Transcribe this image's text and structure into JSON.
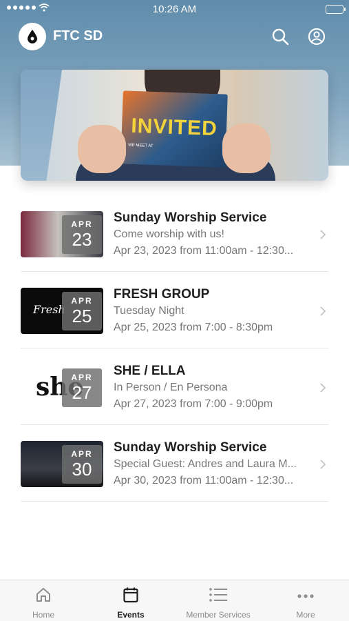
{
  "status_bar": {
    "time": "10:26 AM"
  },
  "app": {
    "title": "FTC SD"
  },
  "banner": {
    "card_title": "INVITED",
    "card_sub": "WE MEET AT"
  },
  "events": [
    {
      "title": "Sunday Worship Service",
      "subtitle": "Come worship with us!",
      "time": "Apr 23, 2023 from 11:00am - 12:30...",
      "month": "APR",
      "day": "23"
    },
    {
      "title": "FRESH GROUP",
      "subtitle": "Tuesday Night",
      "time": "Apr 25, 2023 from 7:00 - 8:30pm",
      "month": "APR",
      "day": "25",
      "thumb_text": "Fresh"
    },
    {
      "title": "SHE / ELLA",
      "subtitle": "In Person / En Persona",
      "time": "Apr 27, 2023 from 7:00 - 9:00pm",
      "month": "APR",
      "day": "27",
      "thumb_text": "she"
    },
    {
      "title": "Sunday Worship Service",
      "subtitle": "Special Guest: Andres and Laura M...",
      "time": "Apr 30, 2023 from 11:00am - 12:30...",
      "month": "APR",
      "day": "30"
    }
  ],
  "tabs": [
    {
      "label": "Home",
      "icon": "home-icon"
    },
    {
      "label": "Events",
      "icon": "calendar-icon",
      "active": true
    },
    {
      "label": "Member Services",
      "icon": "list-icon"
    },
    {
      "label": "More",
      "icon": "more-icon"
    }
  ],
  "colors": {
    "header": "#6e97b4",
    "text": "#1f1f1f",
    "muted": "#777777"
  }
}
